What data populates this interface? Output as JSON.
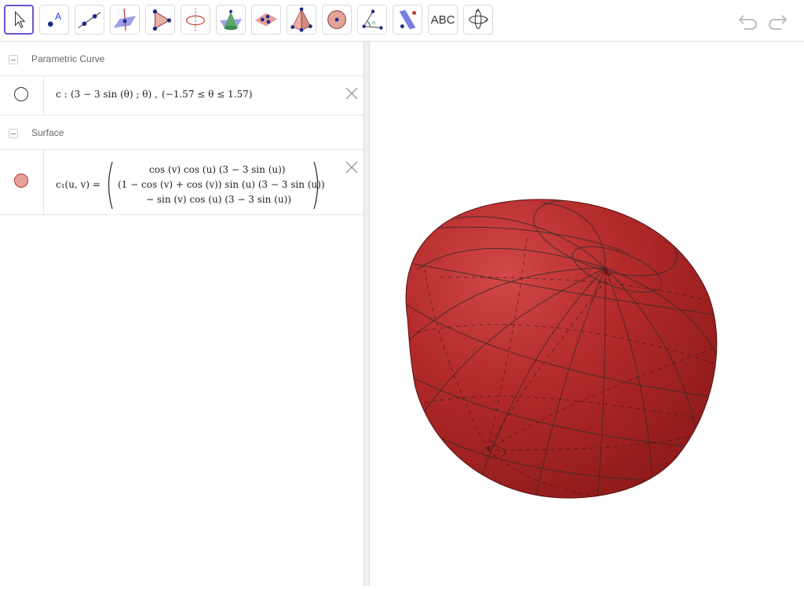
{
  "toolbar": {
    "tools": [
      {
        "name": "move"
      },
      {
        "name": "point"
      },
      {
        "name": "line"
      },
      {
        "name": "perpendicular-line"
      },
      {
        "name": "triangle"
      },
      {
        "name": "intersect"
      },
      {
        "name": "cone"
      },
      {
        "name": "plane-through-points"
      },
      {
        "name": "pyramid"
      },
      {
        "name": "sphere"
      },
      {
        "name": "angle"
      },
      {
        "name": "reflect-about-plane"
      },
      {
        "name": "text",
        "label": "ABC"
      },
      {
        "name": "rotate-view"
      }
    ],
    "accent_color": "#6557d2"
  },
  "algebra": {
    "groups": [
      {
        "name": "Parametric Curve",
        "items": [
          {
            "label": "c :",
            "expr": "(3 − 3  sin (θ) ; θ) ,",
            "range": "(−1.57 ≤ θ ≤ 1.57)",
            "color": "#ffffff"
          }
        ]
      },
      {
        "name": "Surface",
        "items": [
          {
            "label": "c₁(u, v)  =",
            "rows": [
              "cos (v)  cos (u)  (3 − 3  sin (u))",
              "(1 − cos (v) + cos (v))  sin (u)  (3 − 3  sin (u))",
              "− sin (v)  cos (u)  (3 − 3  sin (u))"
            ],
            "color": "#e6a09a"
          }
        ]
      }
    ]
  },
  "graphics": {
    "surface_color": "#b22222"
  }
}
